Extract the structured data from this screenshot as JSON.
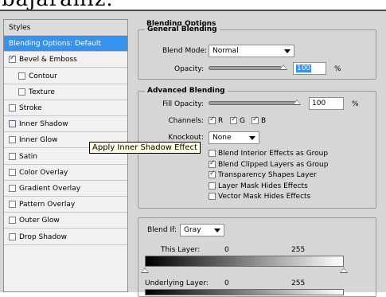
{
  "top_text": "bajaranız.",
  "list": {
    "items": [
      {
        "label": "Styles",
        "kind": "header"
      },
      {
        "label": "Blending Options: Default",
        "kind": "selected"
      },
      {
        "label": "Bevel & Emboss",
        "checked": true
      },
      {
        "label": "Contour",
        "checked": false,
        "indent": true
      },
      {
        "label": "Texture",
        "checked": false,
        "indent": true
      },
      {
        "label": "Stroke",
        "checked": false
      },
      {
        "label": "Inner Shadow",
        "checked": false,
        "hover": true
      },
      {
        "label": "Inner Glow",
        "checked": false
      },
      {
        "label": "Satin",
        "checked": false
      },
      {
        "label": "Color Overlay",
        "checked": false
      },
      {
        "label": "Gradient Overlay",
        "checked": false
      },
      {
        "label": "Pattern Overlay",
        "checked": false
      },
      {
        "label": "Outer Glow",
        "checked": false
      },
      {
        "label": "Drop Shadow",
        "checked": false
      }
    ]
  },
  "tooltip": "Apply Inner Shadow Effect",
  "blending": {
    "title": "Blending Options",
    "general_legend": "General Blending",
    "blend_mode_label": "Blend Mode:",
    "blend_mode_value": "Normal",
    "opacity_label": "Opacity:",
    "opacity_value": "100",
    "pct": "%"
  },
  "advanced": {
    "legend": "Advanced Blending",
    "fill_label": "Fill Opacity:",
    "fill_value": "100",
    "pct": "%",
    "channels_label": "Channels:",
    "channels": [
      {
        "label": "R",
        "checked": true
      },
      {
        "label": "G",
        "checked": true
      },
      {
        "label": "B",
        "checked": true
      }
    ],
    "knockout_label": "Knockout:",
    "knockout_value": "None",
    "options": [
      {
        "label": "Blend Interior Effects as Group",
        "checked": false
      },
      {
        "label": "Blend Clipped Layers as Group",
        "checked": true
      },
      {
        "label": "Transparency Shapes Layer",
        "checked": true
      },
      {
        "label": "Layer Mask Hides Effects",
        "checked": false
      },
      {
        "label": "Vector Mask Hides Effects",
        "checked": false
      }
    ]
  },
  "blendif": {
    "label": "Blend If:",
    "value": "Gray",
    "this_layer_label": "This Layer:",
    "this_low": "0",
    "this_high": "255",
    "under_label": "Underlying Layer:",
    "under_low": "0",
    "under_high": "255"
  }
}
